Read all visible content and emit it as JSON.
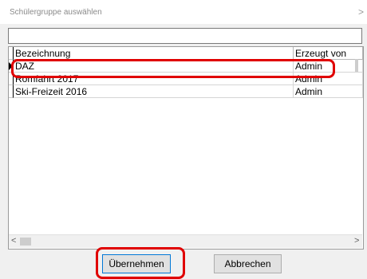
{
  "dialog": {
    "title": "Schülergruppe auswählen",
    "close_glyph": ">"
  },
  "search": {
    "value": "",
    "placeholder": ""
  },
  "table": {
    "columns": [
      "Bezeichnung",
      "Erzeugt von"
    ],
    "rows": [
      {
        "name": "DAZ",
        "creator": "Admin",
        "current": true
      },
      {
        "name": "Romfahrt 2017",
        "creator": "Admin",
        "current": false
      },
      {
        "name": "Ski-Freizeit 2016",
        "creator": "Admin",
        "current": false
      }
    ]
  },
  "scrollbar": {
    "left_arrow": "<",
    "right_arrow": ">"
  },
  "buttons": {
    "ok": "Übernehmen",
    "cancel": "Abbrechen"
  },
  "highlight_color": "#e00000"
}
